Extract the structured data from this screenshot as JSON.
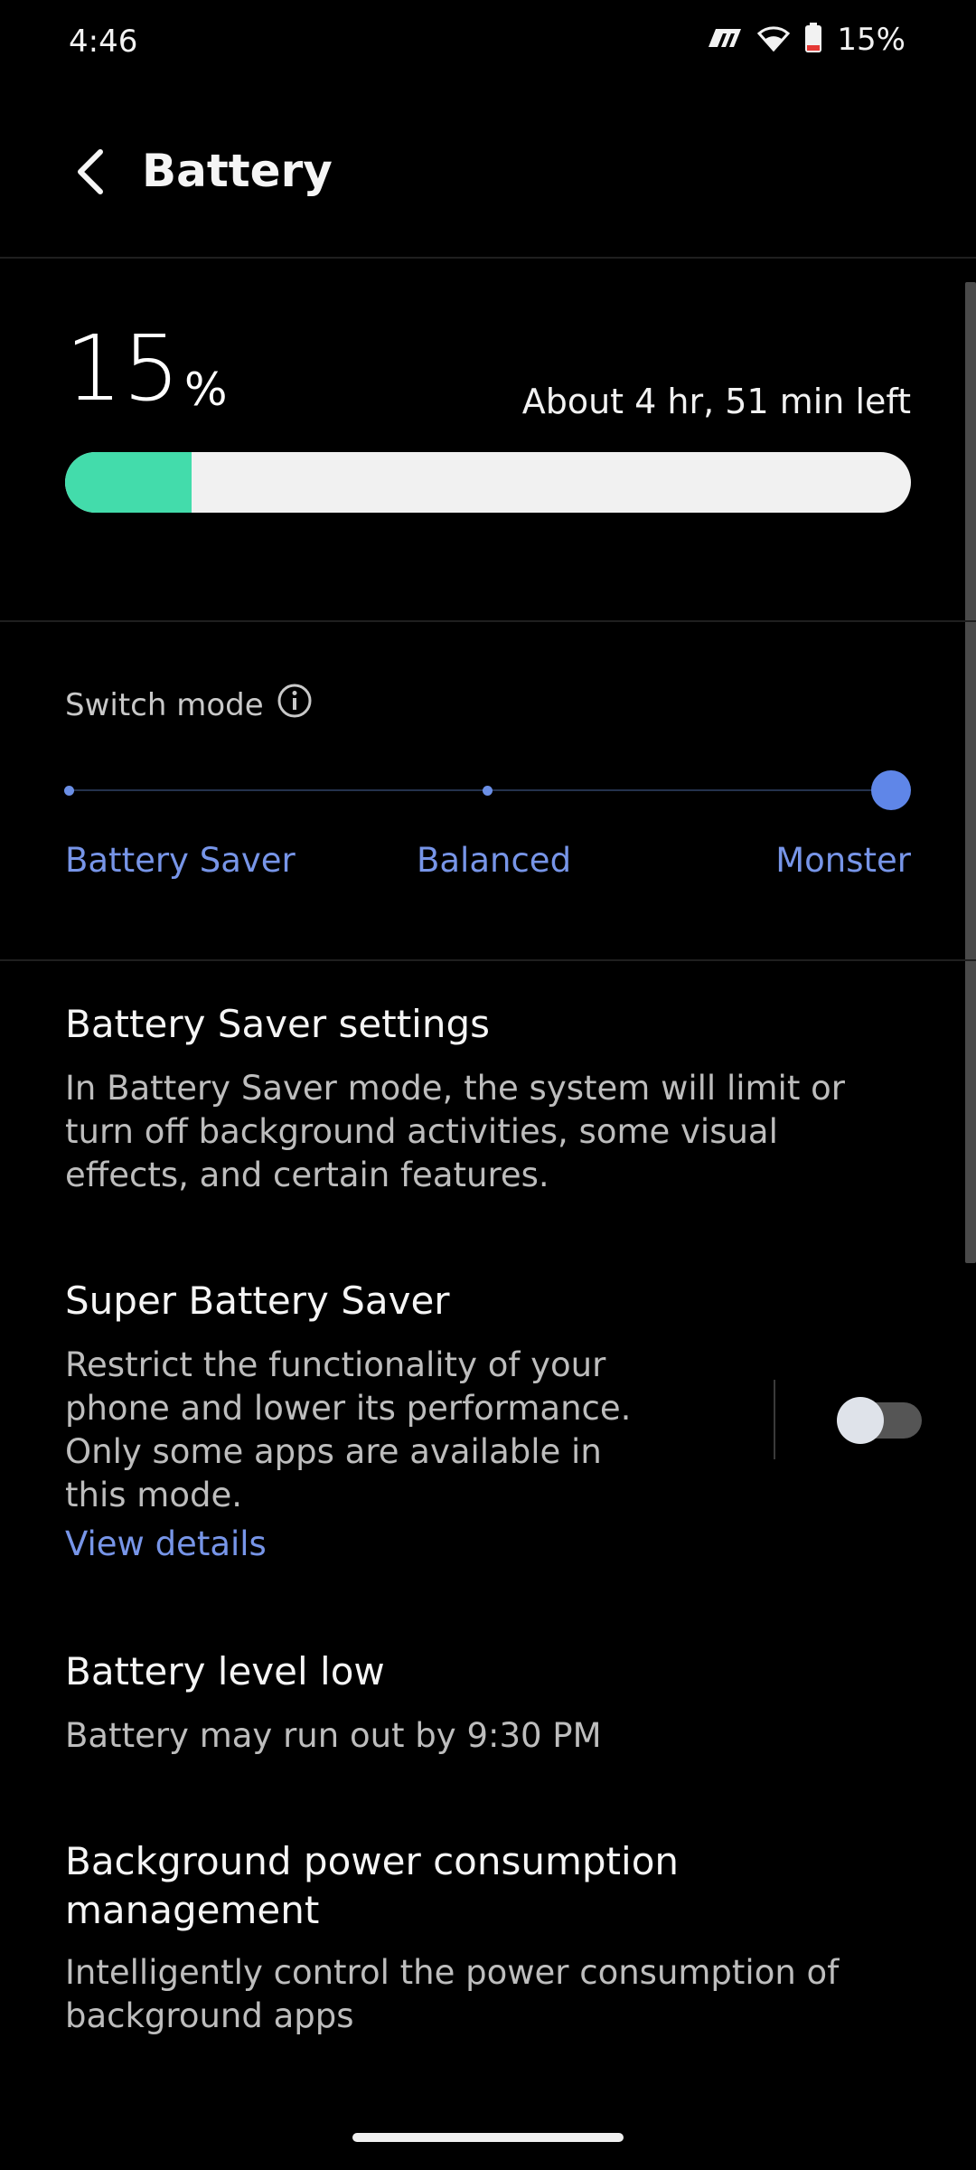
{
  "status_bar": {
    "time": "4:46",
    "carrier_icon": "carrier-logo-icon",
    "wifi_icon": "wifi-icon",
    "battery_icon": "battery-low-icon",
    "battery_percent": "15%"
  },
  "header": {
    "back_icon": "chevron-left-icon",
    "title": "Battery"
  },
  "battery": {
    "value": "15",
    "unit": "%",
    "remaining": "About 4 hr, 51 min left",
    "level_fraction": 0.15,
    "fill_color": "#43dcab"
  },
  "switch_mode": {
    "label": "Switch mode",
    "info_icon": "info-icon",
    "modes": [
      "Battery Saver",
      "Balanced",
      "Monster"
    ],
    "selected": "Monster",
    "accent": "#5f86e8"
  },
  "items": {
    "battery_saver": {
      "title": "Battery Saver settings",
      "desc": "In Battery Saver mode, the system will limit or turn off background activities, some visual effects, and certain features."
    },
    "super_saver": {
      "title": "Super Battery Saver",
      "desc": "Restrict the functionality of your phone and lower its performance. Only some apps are available in this mode.",
      "link": "View details",
      "enabled": false
    },
    "level_low": {
      "title": "Battery level low",
      "desc": "Battery may run out by 9:30 PM"
    },
    "background": {
      "title": "Background power consumption management",
      "desc": "Intelligently control the power consumption of background apps"
    }
  }
}
